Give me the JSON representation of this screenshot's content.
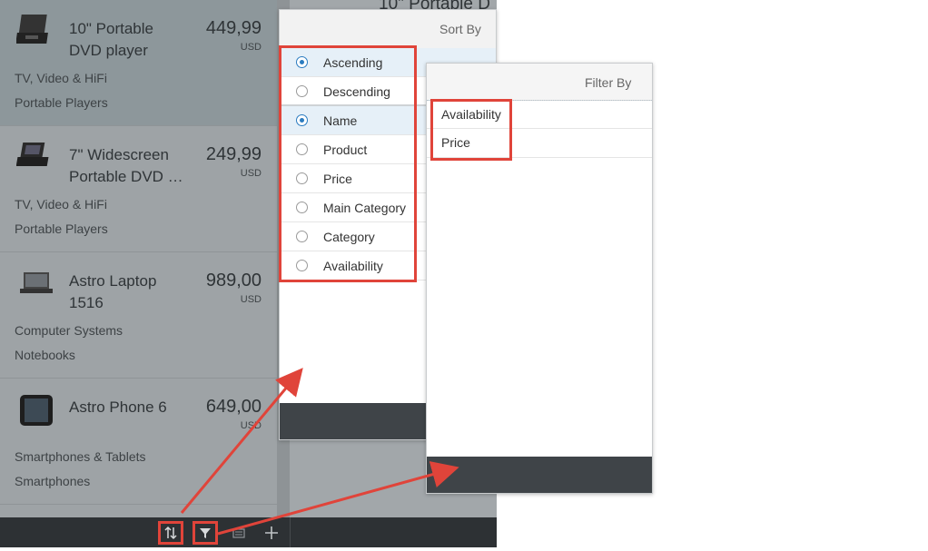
{
  "products": [
    {
      "name_line1": "10\" Portable",
      "name_line2": "DVD player",
      "price": "449,99",
      "currency": "USD",
      "category": "TV, Video & HiFi",
      "subcategory": "Portable Players",
      "thumb_icon": "dvd-player-icon"
    },
    {
      "name_line1": "7\" Widescreen",
      "name_line2": "Portable DVD Player",
      "price": "249,99",
      "currency": "USD",
      "category": "TV, Video & HiFi",
      "subcategory": "Portable Players",
      "thumb_icon": "widescreen-dvd-icon"
    },
    {
      "name_line1": "Astro Laptop",
      "name_line2": "1516",
      "price": "989,00",
      "currency": "USD",
      "category": "Computer Systems",
      "subcategory": "Notebooks",
      "thumb_icon": "laptop-icon"
    },
    {
      "name_line1": "Astro Phone 6",
      "name_line2": "",
      "price": "649,00",
      "currency": "USD",
      "category": "Smartphones & Tablets",
      "subcategory": "Smartphones",
      "thumb_icon": "phone-icon"
    }
  ],
  "detail": {
    "header_text": "10\" Portable D"
  },
  "footer": {
    "icons": [
      "sort-icon",
      "filter-icon",
      "group-icon",
      "add-icon"
    ]
  },
  "sort_dialog": {
    "title": "Sort By",
    "order_options": [
      {
        "label": "Ascending",
        "selected": true
      },
      {
        "label": "Descending",
        "selected": false
      }
    ],
    "field_options": [
      {
        "label": "Name",
        "selected": true
      },
      {
        "label": "Product",
        "selected": false
      },
      {
        "label": "Price",
        "selected": false
      },
      {
        "label": "Main Category",
        "selected": false
      },
      {
        "label": "Category",
        "selected": false
      },
      {
        "label": "Availability",
        "selected": false
      }
    ]
  },
  "filter_dialog": {
    "title": "Filter By",
    "options": [
      "Availability",
      "Price"
    ]
  },
  "colors": {
    "highlight": "#e0443a",
    "selected_row": "#e6f0f8",
    "radio_on": "#2b7cc0"
  }
}
